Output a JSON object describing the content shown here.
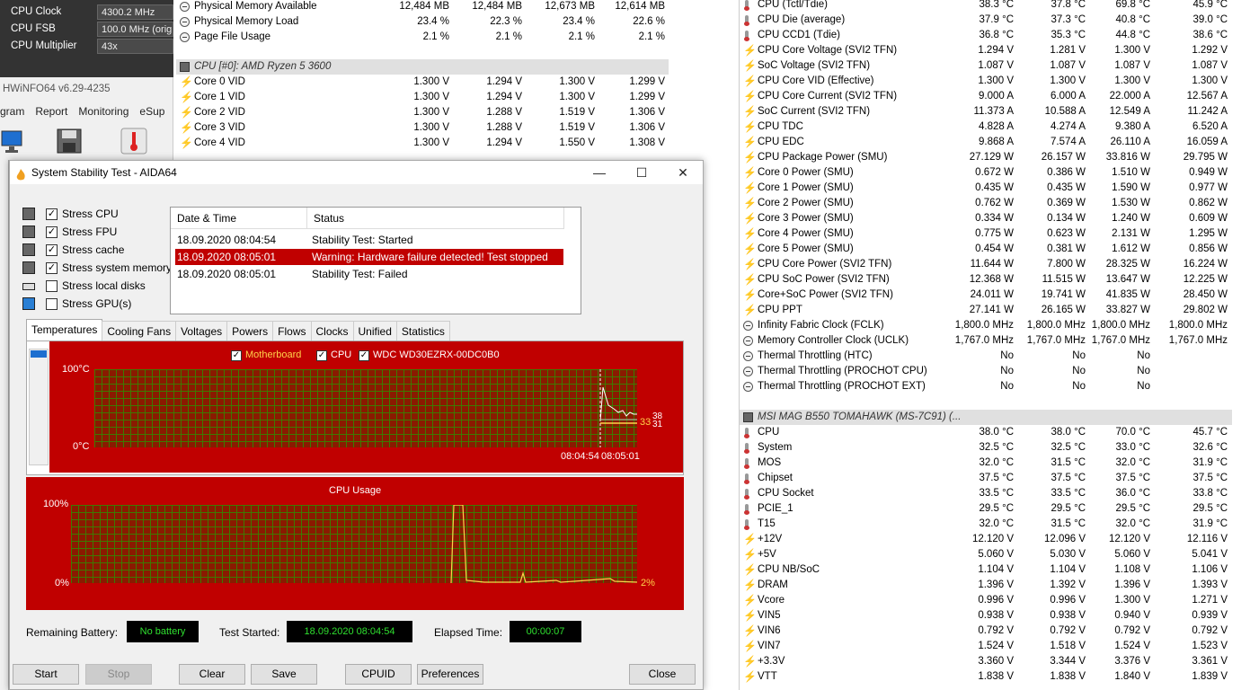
{
  "clock_panel": {
    "rows": [
      {
        "label": "CPU Clock",
        "value": "4300.2 MHz"
      },
      {
        "label": "CPU FSB",
        "value": "100.0 MHz  (orig"
      },
      {
        "label": "CPU Multiplier",
        "value": "43x"
      }
    ]
  },
  "hwinfo": {
    "title": "HWiNFO64 v6.29-4235",
    "menu": [
      "gram",
      "Report",
      "Monitoring",
      "eSup"
    ]
  },
  "mid_table": {
    "rows": [
      {
        "name": "Physical Memory Available",
        "v": [
          "12,484 MB",
          "12,484 MB",
          "12,673 MB",
          "12,614 MB"
        ],
        "icon": "circle-icon"
      },
      {
        "name": "Physical Memory Load",
        "v": [
          "23.4 %",
          "22.3 %",
          "23.4 %",
          "22.6 %"
        ],
        "icon": "circle-icon"
      },
      {
        "name": "Page File Usage",
        "v": [
          "2.1 %",
          "2.1 %",
          "2.1 %",
          "2.1 %"
        ],
        "icon": "circle-icon"
      }
    ],
    "group": "CPU [#0]: AMD Ryzen 5 3600",
    "group_rows": [
      {
        "name": "Core 0 VID",
        "v": [
          "1.300 V",
          "1.294 V",
          "1.300 V",
          "1.299 V"
        ]
      },
      {
        "name": "Core 1 VID",
        "v": [
          "1.300 V",
          "1.294 V",
          "1.300 V",
          "1.299 V"
        ]
      },
      {
        "name": "Core 2 VID",
        "v": [
          "1.300 V",
          "1.288 V",
          "1.519 V",
          "1.306 V"
        ]
      },
      {
        "name": "Core 3 VID",
        "v": [
          "1.300 V",
          "1.288 V",
          "1.519 V",
          "1.306 V"
        ]
      },
      {
        "name": "Core 4 VID",
        "v": [
          "1.300 V",
          "1.294 V",
          "1.550 V",
          "1.308 V"
        ]
      }
    ]
  },
  "right_table": {
    "rows": [
      {
        "name": "CPU (Tctl/Tdie)",
        "v": [
          "38.3 °C",
          "37.8 °C",
          "69.8 °C",
          "45.9 °C"
        ],
        "icon": "therm"
      },
      {
        "name": "CPU Die (average)",
        "v": [
          "37.9 °C",
          "37.3 °C",
          "40.8 °C",
          "39.0 °C"
        ],
        "icon": "therm"
      },
      {
        "name": "CPU CCD1 (Tdie)",
        "v": [
          "36.8 °C",
          "35.3 °C",
          "44.8 °C",
          "38.6 °C"
        ],
        "icon": "therm"
      },
      {
        "name": "CPU Core Voltage (SVI2 TFN)",
        "v": [
          "1.294 V",
          "1.281 V",
          "1.300 V",
          "1.292 V"
        ],
        "icon": "bolt"
      },
      {
        "name": "SoC Voltage (SVI2 TFN)",
        "v": [
          "1.087 V",
          "1.087 V",
          "1.087 V",
          "1.087 V"
        ],
        "icon": "bolt"
      },
      {
        "name": "CPU Core VID (Effective)",
        "v": [
          "1.300 V",
          "1.300 V",
          "1.300 V",
          "1.300 V"
        ],
        "icon": "bolt"
      },
      {
        "name": "CPU Core Current (SVI2 TFN)",
        "v": [
          "9.000 A",
          "6.000 A",
          "22.000 A",
          "12.567 A"
        ],
        "icon": "bolt"
      },
      {
        "name": "SoC Current (SVI2 TFN)",
        "v": [
          "11.373 A",
          "10.588 A",
          "12.549 A",
          "11.242 A"
        ],
        "icon": "bolt"
      },
      {
        "name": "CPU TDC",
        "v": [
          "4.828 A",
          "4.274 A",
          "9.380 A",
          "6.520 A"
        ],
        "icon": "bolt"
      },
      {
        "name": "CPU EDC",
        "v": [
          "9.868 A",
          "7.574 A",
          "26.110 A",
          "16.059 A"
        ],
        "icon": "bolt"
      },
      {
        "name": "CPU Package Power (SMU)",
        "v": [
          "27.129 W",
          "26.157 W",
          "33.816 W",
          "29.795 W"
        ],
        "icon": "bolt"
      },
      {
        "name": "Core 0 Power (SMU)",
        "v": [
          "0.672 W",
          "0.386 W",
          "1.510 W",
          "0.949 W"
        ],
        "icon": "bolt"
      },
      {
        "name": "Core 1 Power (SMU)",
        "v": [
          "0.435 W",
          "0.435 W",
          "1.590 W",
          "0.977 W"
        ],
        "icon": "bolt"
      },
      {
        "name": "Core 2 Power (SMU)",
        "v": [
          "0.762 W",
          "0.369 W",
          "1.530 W",
          "0.862 W"
        ],
        "icon": "bolt"
      },
      {
        "name": "Core 3 Power (SMU)",
        "v": [
          "0.334 W",
          "0.134 W",
          "1.240 W",
          "0.609 W"
        ],
        "icon": "bolt"
      },
      {
        "name": "Core 4 Power (SMU)",
        "v": [
          "0.775 W",
          "0.623 W",
          "2.131 W",
          "1.295 W"
        ],
        "icon": "bolt"
      },
      {
        "name": "Core 5 Power (SMU)",
        "v": [
          "0.454 W",
          "0.381 W",
          "1.612 W",
          "0.856 W"
        ],
        "icon": "bolt"
      },
      {
        "name": "CPU Core Power (SVI2 TFN)",
        "v": [
          "11.644 W",
          "7.800 W",
          "28.325 W",
          "16.224 W"
        ],
        "icon": "bolt"
      },
      {
        "name": "CPU SoC Power (SVI2 TFN)",
        "v": [
          "12.368 W",
          "11.515 W",
          "13.647 W",
          "12.225 W"
        ],
        "icon": "bolt"
      },
      {
        "name": "Core+SoC Power (SVI2 TFN)",
        "v": [
          "24.011 W",
          "19.741 W",
          "41.835 W",
          "28.450 W"
        ],
        "icon": "bolt"
      },
      {
        "name": "CPU PPT",
        "v": [
          "27.141 W",
          "26.165 W",
          "33.827 W",
          "29.802 W"
        ],
        "icon": "bolt"
      },
      {
        "name": "Infinity Fabric Clock (FCLK)",
        "v": [
          "1,800.0 MHz",
          "1,800.0 MHz",
          "1,800.0 MHz",
          "1,800.0 MHz"
        ],
        "icon": "circle"
      },
      {
        "name": "Memory Controller Clock (UCLK)",
        "v": [
          "1,767.0 MHz",
          "1,767.0 MHz",
          "1,767.0 MHz",
          "1,767.0 MHz"
        ],
        "icon": "circle"
      },
      {
        "name": "Thermal Throttling (HTC)",
        "v": [
          "No",
          "No",
          "No",
          ""
        ],
        "icon": "circle"
      },
      {
        "name": "Thermal Throttling (PROCHOT CPU)",
        "v": [
          "No",
          "No",
          "No",
          ""
        ],
        "icon": "circle"
      },
      {
        "name": "Thermal Throttling (PROCHOT EXT)",
        "v": [
          "No",
          "No",
          "No",
          ""
        ],
        "icon": "circle"
      }
    ],
    "group": "MSI MAG B550 TOMAHAWK (MS-7C91) (...",
    "group_rows": [
      {
        "name": "CPU",
        "v": [
          "38.0 °C",
          "38.0 °C",
          "70.0 °C",
          "45.7 °C"
        ],
        "icon": "therm"
      },
      {
        "name": "System",
        "v": [
          "32.5 °C",
          "32.5 °C",
          "33.0 °C",
          "32.6 °C"
        ],
        "icon": "therm"
      },
      {
        "name": "MOS",
        "v": [
          "32.0 °C",
          "31.5 °C",
          "32.0 °C",
          "31.9 °C"
        ],
        "icon": "therm"
      },
      {
        "name": "Chipset",
        "v": [
          "37.5 °C",
          "37.5 °C",
          "37.5 °C",
          "37.5 °C"
        ],
        "icon": "therm"
      },
      {
        "name": "CPU Socket",
        "v": [
          "33.5 °C",
          "33.5 °C",
          "36.0 °C",
          "33.8 °C"
        ],
        "icon": "therm"
      },
      {
        "name": "PCIE_1",
        "v": [
          "29.5 °C",
          "29.5 °C",
          "29.5 °C",
          "29.5 °C"
        ],
        "icon": "therm"
      },
      {
        "name": "T15",
        "v": [
          "32.0 °C",
          "31.5 °C",
          "32.0 °C",
          "31.9 °C"
        ],
        "icon": "therm"
      },
      {
        "name": "+12V",
        "v": [
          "12.120 V",
          "12.096 V",
          "12.120 V",
          "12.116 V"
        ],
        "icon": "bolt"
      },
      {
        "name": "+5V",
        "v": [
          "5.060 V",
          "5.030 V",
          "5.060 V",
          "5.041 V"
        ],
        "icon": "bolt"
      },
      {
        "name": "CPU NB/SoC",
        "v": [
          "1.104 V",
          "1.104 V",
          "1.108 V",
          "1.106 V"
        ],
        "icon": "bolt"
      },
      {
        "name": "DRAM",
        "v": [
          "1.396 V",
          "1.392 V",
          "1.396 V",
          "1.393 V"
        ],
        "icon": "bolt"
      },
      {
        "name": "Vcore",
        "v": [
          "0.996 V",
          "0.996 V",
          "1.300 V",
          "1.271 V"
        ],
        "icon": "bolt"
      },
      {
        "name": "VIN5",
        "v": [
          "0.938 V",
          "0.938 V",
          "0.940 V",
          "0.939 V"
        ],
        "icon": "bolt"
      },
      {
        "name": "VIN6",
        "v": [
          "0.792 V",
          "0.792 V",
          "0.792 V",
          "0.792 V"
        ],
        "icon": "bolt"
      },
      {
        "name": "VIN7",
        "v": [
          "1.524 V",
          "1.518 V",
          "1.524 V",
          "1.523 V"
        ],
        "icon": "bolt"
      },
      {
        "name": "+3.3V",
        "v": [
          "3.360 V",
          "3.344 V",
          "3.376 V",
          "3.361 V"
        ],
        "icon": "bolt"
      },
      {
        "name": "VTT",
        "v": [
          "1.838 V",
          "1.838 V",
          "1.840 V",
          "1.839 V"
        ],
        "icon": "bolt"
      }
    ]
  },
  "aida": {
    "title": "System Stability Test - AIDA64",
    "stress": [
      {
        "label": "Stress CPU",
        "checked": true
      },
      {
        "label": "Stress FPU",
        "checked": true
      },
      {
        "label": "Stress cache",
        "checked": true
      },
      {
        "label": "Stress system memory",
        "checked": true
      },
      {
        "label": "Stress local disks",
        "checked": false
      },
      {
        "label": "Stress GPU(s)",
        "checked": false
      }
    ],
    "log_headers": [
      "Date & Time",
      "Status"
    ],
    "log": [
      {
        "time": "18.09.2020 08:04:54",
        "status": "Stability Test: Started"
      },
      {
        "time": "18.09.2020 08:05:01",
        "status": "Warning: Hardware failure detected! Test stopped"
      },
      {
        "time": "18.09.2020 08:05:01",
        "status": "Stability Test: Failed"
      }
    ],
    "tabs": [
      "Temperatures",
      "Cooling Fans",
      "Voltages",
      "Powers",
      "Flows",
      "Clocks",
      "Unified",
      "Statistics"
    ],
    "temp_graph": {
      "legend": [
        "Motherboard",
        "CPU",
        "WDC WD30EZRX-00DC0B0"
      ],
      "ymax": "100°C",
      "ymin": "0°C",
      "times": [
        "08:04:54",
        "08:05:01"
      ],
      "end_labels": [
        "33",
        "38",
        "31"
      ]
    },
    "cpu_graph": {
      "title": "CPU Usage",
      "ymax": "100%",
      "ymin": "0%",
      "end_label": "2%"
    },
    "bottom": {
      "battery_label": "Remaining Battery:",
      "battery_value": "No battery",
      "started_label": "Test Started:",
      "started_value": "18.09.2020 08:04:54",
      "elapsed_label": "Elapsed Time:",
      "elapsed_value": "00:00:07"
    },
    "buttons": [
      "Start",
      "Stop",
      "Clear",
      "Save",
      "CPUID",
      "Preferences",
      "Close"
    ]
  },
  "colors": {
    "graph_bg": "#c00000",
    "grid": "#3e7a00",
    "status_text": "#2fe02f"
  }
}
